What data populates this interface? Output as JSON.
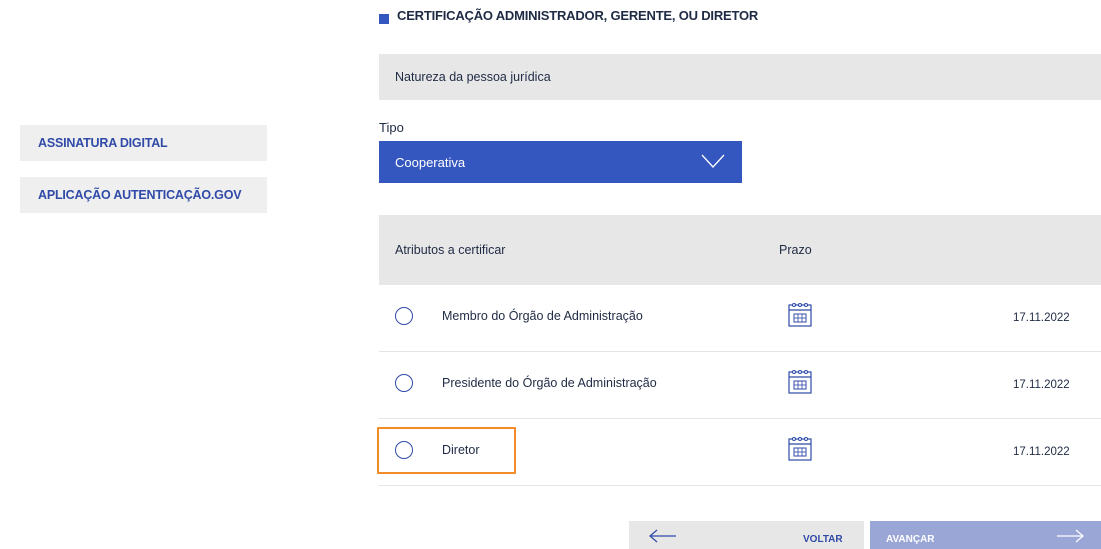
{
  "sidebar": {
    "items": [
      {
        "label": "ASSINATURA DIGITAL"
      },
      {
        "label": "APLICAÇÃO AUTENTICAÇÃO.GOV"
      }
    ]
  },
  "section": {
    "title": "CERTIFICAÇÃO ADMINISTRADOR, GERENTE, OU DIRETOR"
  },
  "subsection": {
    "title": "Natureza da pessoa jurídica"
  },
  "tipo": {
    "label": "Tipo",
    "selected": "Cooperativa"
  },
  "table": {
    "headers": {
      "attributes": "Atributos a certificar",
      "deadline": "Prazo"
    },
    "rows": [
      {
        "label": "Membro do Órgão de Administração",
        "date": "17.11.2022"
      },
      {
        "label": "Presidente do Órgão de Administração",
        "date": "17.11.2022"
      },
      {
        "label": "Diretor",
        "date": "17.11.2022"
      }
    ]
  },
  "nav": {
    "back_label": "VOLTAR",
    "next_label": "AVANÇAR"
  },
  "colors": {
    "primary": "#3456bf",
    "highlight": "#f28c28",
    "panel": "#e7e7e7"
  }
}
